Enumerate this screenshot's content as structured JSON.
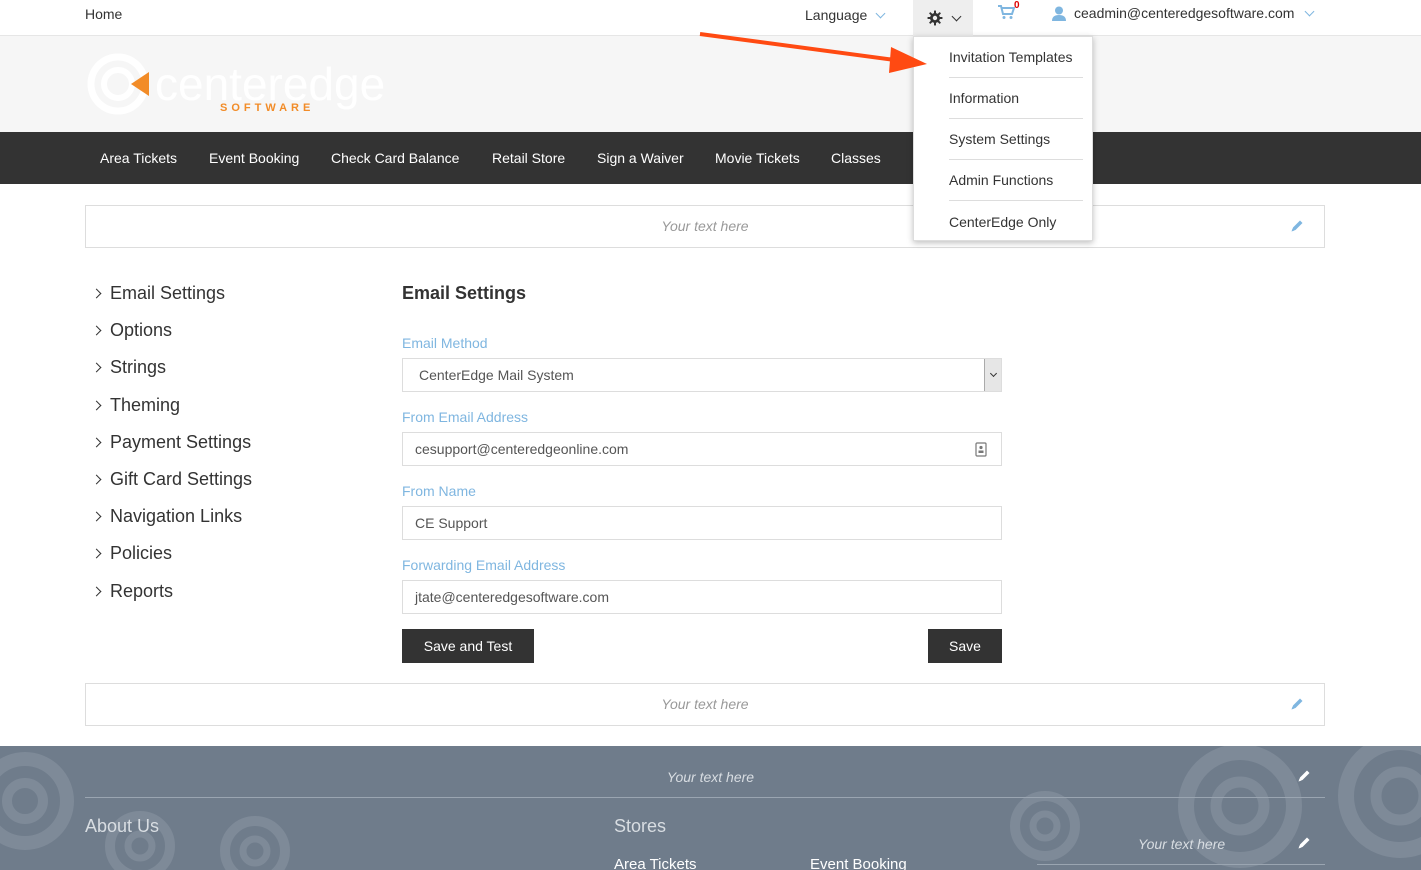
{
  "topbar": {
    "home": "Home",
    "language": "Language",
    "cart_count": "0",
    "user_email": "ceadmin@centeredgesoftware.com"
  },
  "settings_menu": {
    "items": [
      "Invitation Templates",
      "Information",
      "System Settings",
      "Admin Functions",
      "CenterEdge Only"
    ]
  },
  "logo": {
    "software": "SOFTWARE"
  },
  "nav": {
    "items": [
      "Area Tickets",
      "Event Booking",
      "Check Card Balance",
      "Retail Store",
      "Sign a Waiver",
      "Movie Tickets",
      "Classes"
    ]
  },
  "placeholder_text": "Your text here",
  "sidebar": {
    "items": [
      "Email Settings",
      "Options",
      "Strings",
      "Theming",
      "Payment Settings",
      "Gift Card Settings",
      "Navigation Links",
      "Policies",
      "Reports"
    ]
  },
  "form": {
    "title": "Email Settings",
    "email_method_label": "Email Method",
    "email_method_value": "CenterEdge Mail System",
    "from_email_label": "From Email Address",
    "from_email_value": "cesupport@centeredgeonline.com",
    "from_name_label": "From Name",
    "from_name_value": "CE Support",
    "forwarding_label": "Forwarding Email Address",
    "forwarding_value": "jtate@centeredgesoftware.com",
    "save_test_label": "Save and Test",
    "save_label": "Save"
  },
  "footer": {
    "about_us": "About Us",
    "stores": "Stores",
    "link_area_tickets": "Area Tickets",
    "link_event_booking": "Event Booking"
  },
  "colors": {
    "accent": "#7fb6e0",
    "brand_orange": "#f28c28",
    "navbar": "#333333",
    "footer": "#6f7c8b",
    "arrow": "#ff4a12"
  }
}
